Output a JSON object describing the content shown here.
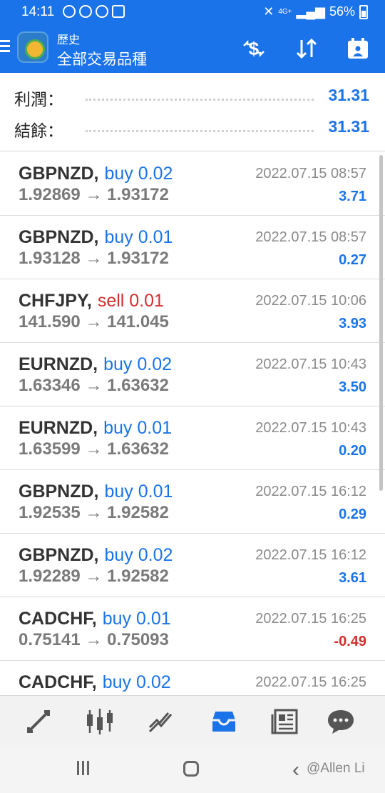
{
  "status_bar": {
    "time": "14:11",
    "network": "4G+",
    "battery": "56%"
  },
  "app_bar": {
    "title": "歷史",
    "subtitle": "全部交易品種",
    "accent_color": "#1a73e8",
    "icons": [
      "menu-icon",
      "app-logo",
      "currency-filter-icon",
      "sort-icon",
      "calendar-icon"
    ]
  },
  "summary": {
    "profit_label": "利潤：",
    "profit_value": "31.31",
    "balance_label": "結餘：",
    "balance_value": "31.31"
  },
  "deals": [
    {
      "symbol": "GBPNZD,",
      "side": "buy",
      "side_text": "buy 0.02",
      "open": "1.92869",
      "close": "1.93172",
      "time": "2022.07.15 08:57",
      "profit": "3.71"
    },
    {
      "symbol": "GBPNZD,",
      "side": "buy",
      "side_text": "buy 0.01",
      "open": "1.93128",
      "close": "1.93172",
      "time": "2022.07.15 08:57",
      "profit": "0.27"
    },
    {
      "symbol": "CHFJPY,",
      "side": "sell",
      "side_text": "sell 0.01",
      "open": "141.590",
      "close": "141.045",
      "time": "2022.07.15 10:06",
      "profit": "3.93"
    },
    {
      "symbol": "EURNZD,",
      "side": "buy",
      "side_text": "buy 0.02",
      "open": "1.63346",
      "close": "1.63632",
      "time": "2022.07.15 10:43",
      "profit": "3.50"
    },
    {
      "symbol": "EURNZD,",
      "side": "buy",
      "side_text": "buy 0.01",
      "open": "1.63599",
      "close": "1.63632",
      "time": "2022.07.15 10:43",
      "profit": "0.20"
    },
    {
      "symbol": "GBPNZD,",
      "side": "buy",
      "side_text": "buy 0.01",
      "open": "1.92535",
      "close": "1.92582",
      "time": "2022.07.15 16:12",
      "profit": "0.29"
    },
    {
      "symbol": "GBPNZD,",
      "side": "buy",
      "side_text": "buy 0.02",
      "open": "1.92289",
      "close": "1.92582",
      "time": "2022.07.15 16:12",
      "profit": "3.61"
    },
    {
      "symbol": "CADCHF,",
      "side": "buy",
      "side_text": "buy 0.01",
      "open": "0.75141",
      "close": "0.75093",
      "time": "2022.07.15 16:25",
      "profit": "-0.49"
    },
    {
      "symbol": "CADCHF,",
      "side": "buy",
      "side_text": "buy 0.02",
      "open": "",
      "close": "",
      "time": "2022.07.15 16:25",
      "profit": ""
    }
  ],
  "price_arrow": "→",
  "tab_bar": {
    "tabs": [
      "quotes-icon",
      "chart-icon",
      "trade-icon",
      "history-icon",
      "news-icon",
      "chat-icon"
    ],
    "active": "history-icon",
    "active_color": "#1a73e8",
    "inactive_color": "#555555"
  },
  "nav_bar": {
    "watermark": "@Allen Li"
  }
}
